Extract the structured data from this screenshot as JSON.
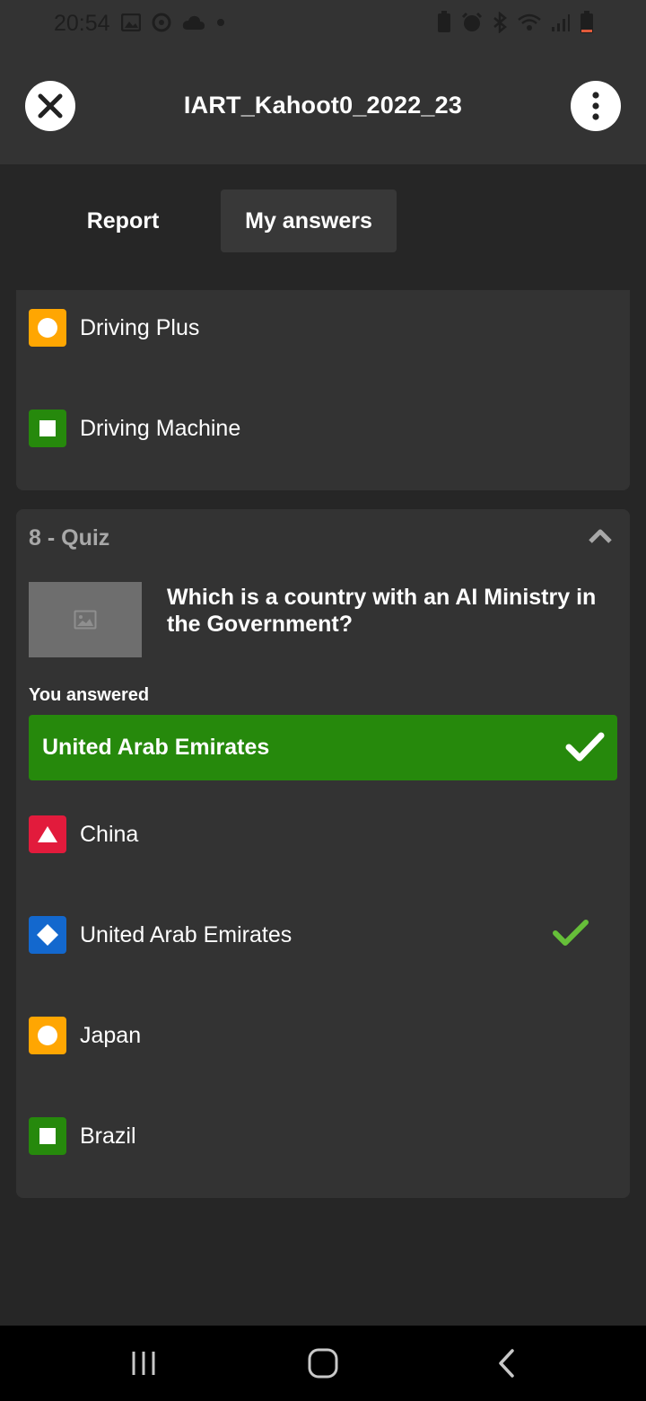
{
  "status_bar": {
    "time": "20:54",
    "left_icons": [
      "image-icon",
      "location-icon",
      "cloud-icon",
      "dot-icon"
    ],
    "right_icons": [
      "battery-saver-icon",
      "alarm-icon",
      "bluetooth-icon",
      "wifi-icon",
      "signal-icon",
      "battery-icon"
    ]
  },
  "header": {
    "title": "IART_Kahoot0_2022_23",
    "close_icon": "close-icon",
    "more_icon": "more-vertical-icon"
  },
  "tabs": [
    {
      "label": "Report",
      "active": false
    },
    {
      "label": "My answers",
      "active": true
    }
  ],
  "previous_question": {
    "answers": [
      {
        "text": "Driving Plus",
        "shape": "circle",
        "color": "#ffa602"
      },
      {
        "text": "Driving Machine",
        "shape": "square",
        "color": "#26890c"
      }
    ]
  },
  "question": {
    "header": "8 - Quiz",
    "text": "Which is a country with an AI Ministry in the Government?",
    "you_answered_label": "You answered",
    "selected_answer": "United Arab Emirates",
    "selected_correct": true,
    "answers": [
      {
        "text": "China",
        "shape": "triangle",
        "color": "#e21b3c",
        "correct": false
      },
      {
        "text": "United Arab Emirates",
        "shape": "diamond",
        "color": "#1368ce",
        "correct": true
      },
      {
        "text": "Japan",
        "shape": "circle",
        "color": "#ffa602",
        "correct": false
      },
      {
        "text": "Brazil",
        "shape": "square",
        "color": "#26890c",
        "correct": false
      }
    ]
  },
  "nav_bar": {
    "icons": [
      "recent-apps-icon",
      "home-icon",
      "back-icon"
    ]
  },
  "colors": {
    "background": "#262626",
    "card": "#333333",
    "correct_green": "#26890c",
    "check_green": "#66bf39"
  }
}
